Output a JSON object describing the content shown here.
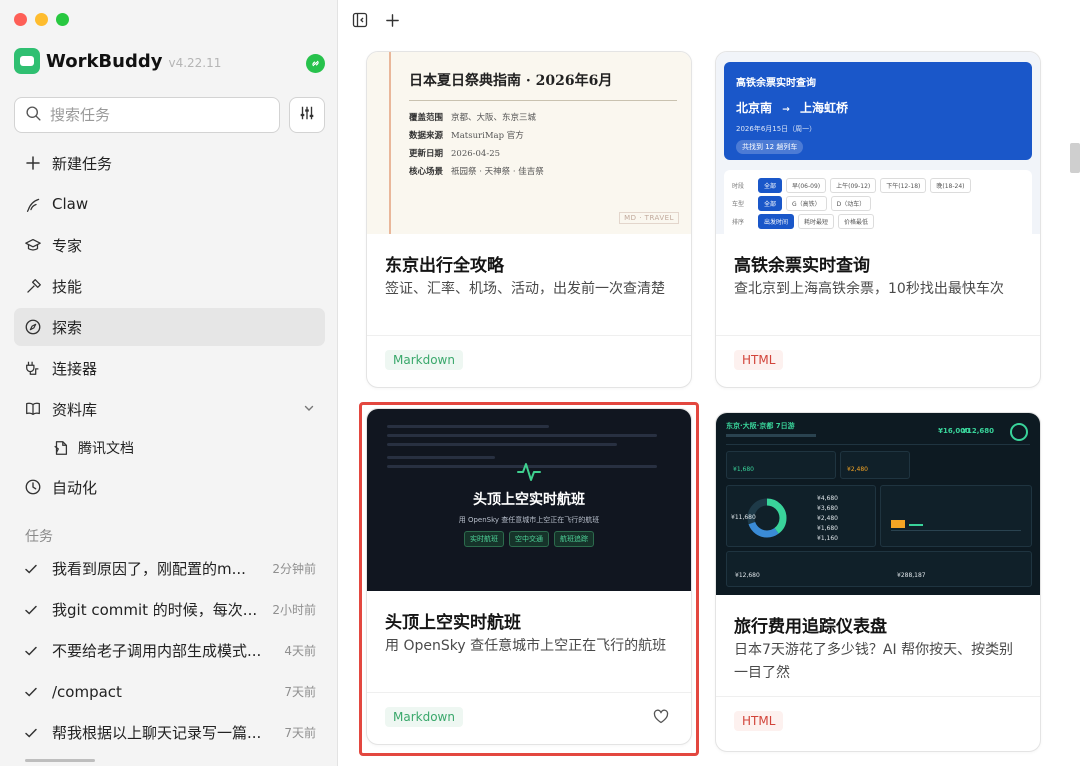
{
  "app": {
    "name": "WorkBuddy",
    "version": "v4.22.11"
  },
  "search": {
    "placeholder": "搜索任务"
  },
  "nav": {
    "new_task": "新建任务",
    "claw": "Claw",
    "experts": "专家",
    "skills": "技能",
    "explore": "探索",
    "connectors": "连接器",
    "library": "资料库",
    "tencent_docs": "腾讯文档",
    "automation": "自动化"
  },
  "tasks_header": "任务",
  "tasks": [
    {
      "title": "我看到原因了，刚配置的m...",
      "time": "2分钟前"
    },
    {
      "title": "我git commit 的时候，每次...",
      "time": "2小时前"
    },
    {
      "title": "不要给老子调用内部生成模式...",
      "time": "4天前"
    },
    {
      "title": "/compact",
      "time": "7天前"
    },
    {
      "title": "帮我根据以上聊天记录写一篇...",
      "time": "7天前"
    }
  ],
  "cards": [
    {
      "title": "东京出行全攻略",
      "desc": "签证、汇率、机场、活动，出发前一次查清楚",
      "tag": "Markdown",
      "preview": {
        "heading": "日本夏日祭典指南 · 2026年6月",
        "rows": [
          {
            "label": "覆盖范围",
            "value": "京都、大阪、东京三城"
          },
          {
            "label": "数据来源",
            "value": "MatsuriMap 官方"
          },
          {
            "label": "更新日期",
            "value": "2026-04-25"
          },
          {
            "label": "核心场景",
            "value": "祇园祭 · 天神祭 · 佳吉祭"
          }
        ],
        "stamp": "MD · TRAVEL"
      }
    },
    {
      "title": "高铁余票实时查询",
      "desc": "查北京到上海高铁余票，10秒找出最快车次",
      "tag": "HTML",
      "preview": {
        "heading": "高铁余票实时查询",
        "from": "北京南",
        "arrow": "→",
        "to": "上海虹桥",
        "date": "2026年6月15日（周一）",
        "count": "共找到 12 趟列车",
        "rows": [
          {
            "label": "时段",
            "chips": [
              "全部",
              "早(06-09)",
              "上午(09-12)",
              "下午(12-18)",
              "晚(18-24)"
            ]
          },
          {
            "label": "车型",
            "chips": [
              "全部",
              "G（高铁）",
              "D（动车）"
            ]
          },
          {
            "label": "排序",
            "chips": [
              "出发时间",
              "耗时最短",
              "价格最低"
            ]
          }
        ]
      }
    },
    {
      "title": "头顶上空实时航班",
      "desc": "用 OpenSky 查任意城市上空正在飞行的航班",
      "tag": "Markdown",
      "preview": {
        "heading": "头顶上空实时航班",
        "sub": "用 OpenSky 查任意城市上空正在飞行的航班",
        "chips": [
          "实时航班",
          "空中交通",
          "航班追踪"
        ]
      }
    },
    {
      "title": "旅行费用追踪仪表盘",
      "desc": "日本7天游花了多少钱？AI 帮你按天、按类别一目了然",
      "tag": "HTML",
      "preview": {
        "heading": "东京·大阪·京都 7日游",
        "total": "¥16,000",
        "total2": "¥12,680",
        "mid_a": "¥1,680",
        "mid_b": "¥2,480",
        "ring_center": "¥11,680",
        "list": [
          "¥4,680",
          "¥3,680",
          "¥2,480",
          "¥1,680",
          "¥1,160"
        ],
        "bottom_left": "¥12,680",
        "bottom_right": "¥288,187"
      }
    }
  ],
  "colors": {
    "accent_green": "#2fbf71",
    "highlight_red": "#e3473f",
    "tag_markdown": "#3aa86b",
    "tag_html": "#d2443a"
  }
}
